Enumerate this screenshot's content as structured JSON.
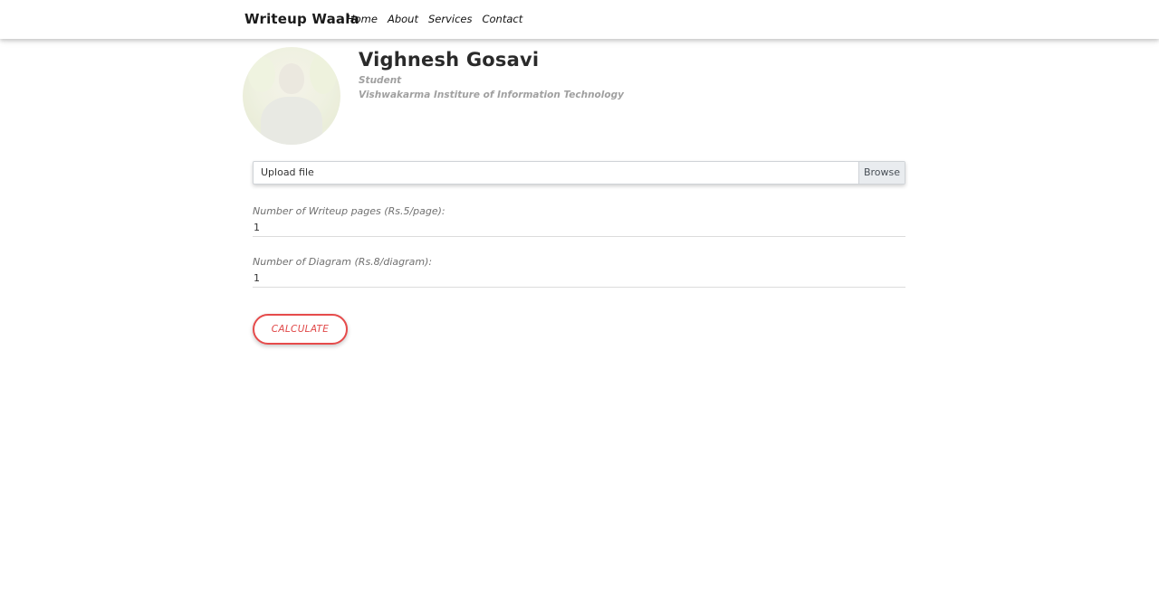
{
  "navbar": {
    "brand": "Writeup Waala",
    "links": [
      {
        "label": "Home"
      },
      {
        "label": "About"
      },
      {
        "label": "Services"
      },
      {
        "label": "Contact"
      }
    ]
  },
  "profile": {
    "name": "Vighnesh Gosavi",
    "role": "Student",
    "institute": "Vishwakarma Institure of Information Technology"
  },
  "upload": {
    "label": "Upload file",
    "browse_label": "Browse"
  },
  "fields": {
    "pages_label": "Number of Writeup pages (Rs.5/page):",
    "pages_value": "1",
    "diagrams_label": "Number of Diagram (Rs.8/diagram):",
    "diagrams_value": "1"
  },
  "actions": {
    "calculate_label": "CALCULATE"
  },
  "colors": {
    "accent": "#e64b4b",
    "muted_text": "#a0a0a0"
  }
}
